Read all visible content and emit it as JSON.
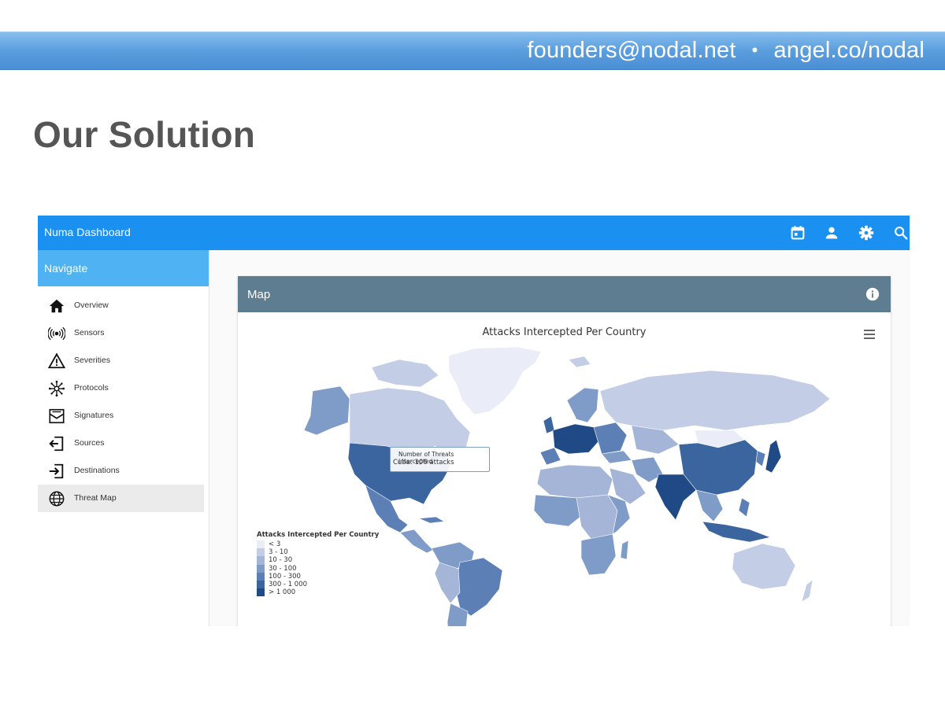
{
  "slide": {
    "contact_email": "founders@nodal.net",
    "contact_separator": "•",
    "contact_site": "angel.co/nodal",
    "title": "Our Solution"
  },
  "dashboard": {
    "app_title": "Numa Dashboard",
    "topbar_icons": [
      "calendar-icon",
      "user-icon",
      "gear-icon",
      "search-icon"
    ],
    "navigate_label": "Navigate",
    "nav_items": [
      {
        "label": "Overview",
        "icon": "home-icon"
      },
      {
        "label": "Sensors",
        "icon": "sensor-icon"
      },
      {
        "label": "Severities",
        "icon": "warning-icon"
      },
      {
        "label": "Protocols",
        "icon": "protocols-icon"
      },
      {
        "label": "Signatures",
        "icon": "signature-icon"
      },
      {
        "label": "Sources",
        "icon": "source-icon"
      },
      {
        "label": "Destinations",
        "icon": "destination-icon"
      },
      {
        "label": "Threat Map",
        "icon": "globe-icon",
        "active": true
      }
    ],
    "card_title": "Map",
    "card_icon": "info-icon"
  },
  "chart_data": {
    "type": "choropleth-map",
    "title": "Attacks Intercepted Per Country",
    "legend_title": "Attacks Intercepted Per Country",
    "classes": [
      {
        "label": "< 3",
        "color": "#eaedf8"
      },
      {
        "label": "3 - 10",
        "color": "#c3cde6"
      },
      {
        "label": "10 - 30",
        "color": "#a5b5d8"
      },
      {
        "label": "30 - 100",
        "color": "#7f9cc8"
      },
      {
        "label": "100 - 300",
        "color": "#5c80b5"
      },
      {
        "label": "300 - 1 000",
        "color": "#3b659f"
      },
      {
        "label": "> 1 000",
        "color": "#1f4a85"
      }
    ],
    "tooltip": {
      "header": "Number of Threats Intercepted",
      "value": "Cuba: 106 attacks"
    }
  }
}
